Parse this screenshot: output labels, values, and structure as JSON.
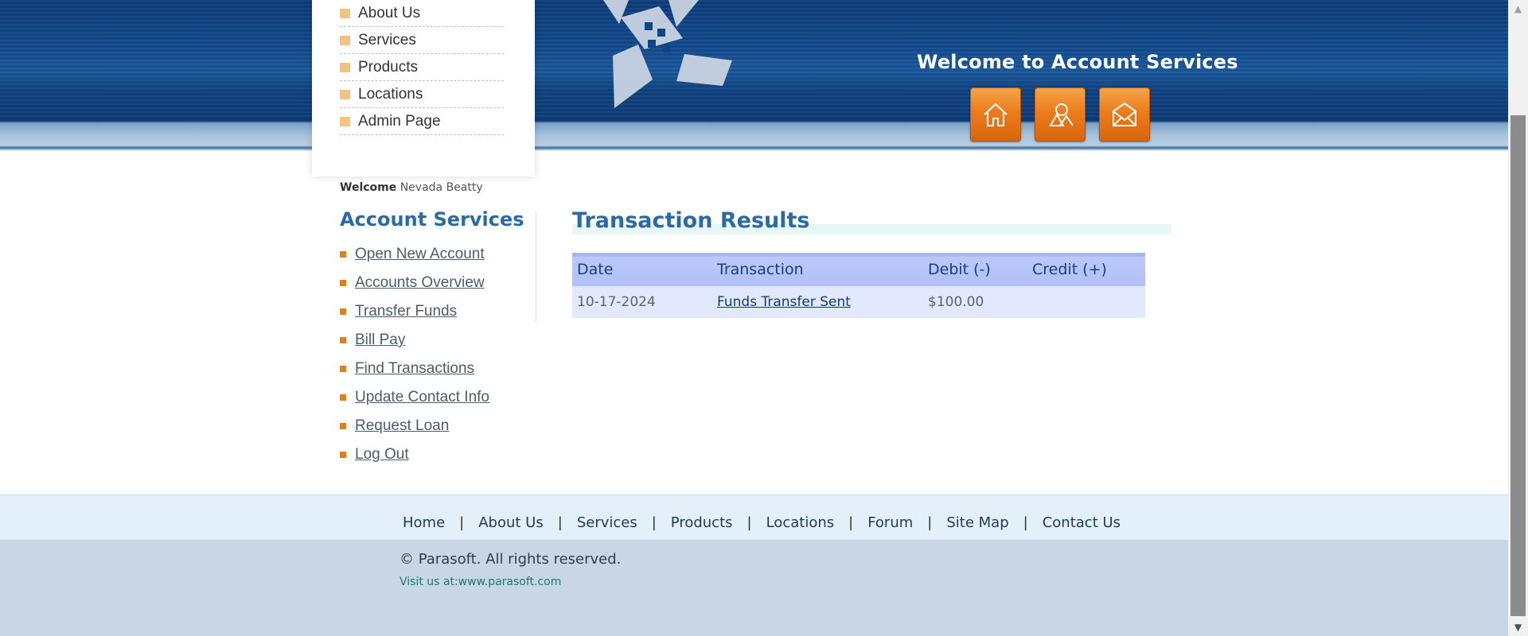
{
  "top_nav": {
    "items": [
      "About Us",
      "Services",
      "Products",
      "Locations",
      "Admin Page"
    ]
  },
  "header": {
    "welcome_banner": "Welcome to Account Services",
    "icons": [
      "home-icon",
      "about-icon",
      "contact-icon"
    ]
  },
  "user": {
    "welcome_label": "Welcome",
    "name": "Nevada Beatty"
  },
  "account_services": {
    "title": "Account Services",
    "links": [
      "Open New Account",
      "Accounts Overview",
      "Transfer Funds",
      "Bill Pay",
      "Find Transactions",
      "Update Contact Info",
      "Request Loan",
      "Log Out"
    ]
  },
  "results": {
    "title": "Transaction Results",
    "columns": [
      "Date",
      "Transaction",
      "Debit (-)",
      "Credit (+)"
    ],
    "rows": [
      {
        "date": "10-17-2024",
        "transaction": "Funds Transfer Sent",
        "debit": "$100.00",
        "credit": ""
      }
    ]
  },
  "footer": {
    "links": [
      "Home",
      "About Us",
      "Services",
      "Products",
      "Locations",
      "Forum",
      "Site Map",
      "Contact Us"
    ],
    "separator": "|",
    "copyright": "© Parasoft. All rights reserved.",
    "visit": "Visit us at:www.parasoft.com"
  },
  "colors": {
    "accent": "#2c6aa6",
    "orange": "#ec7c1b",
    "header_blue": "#114889"
  }
}
